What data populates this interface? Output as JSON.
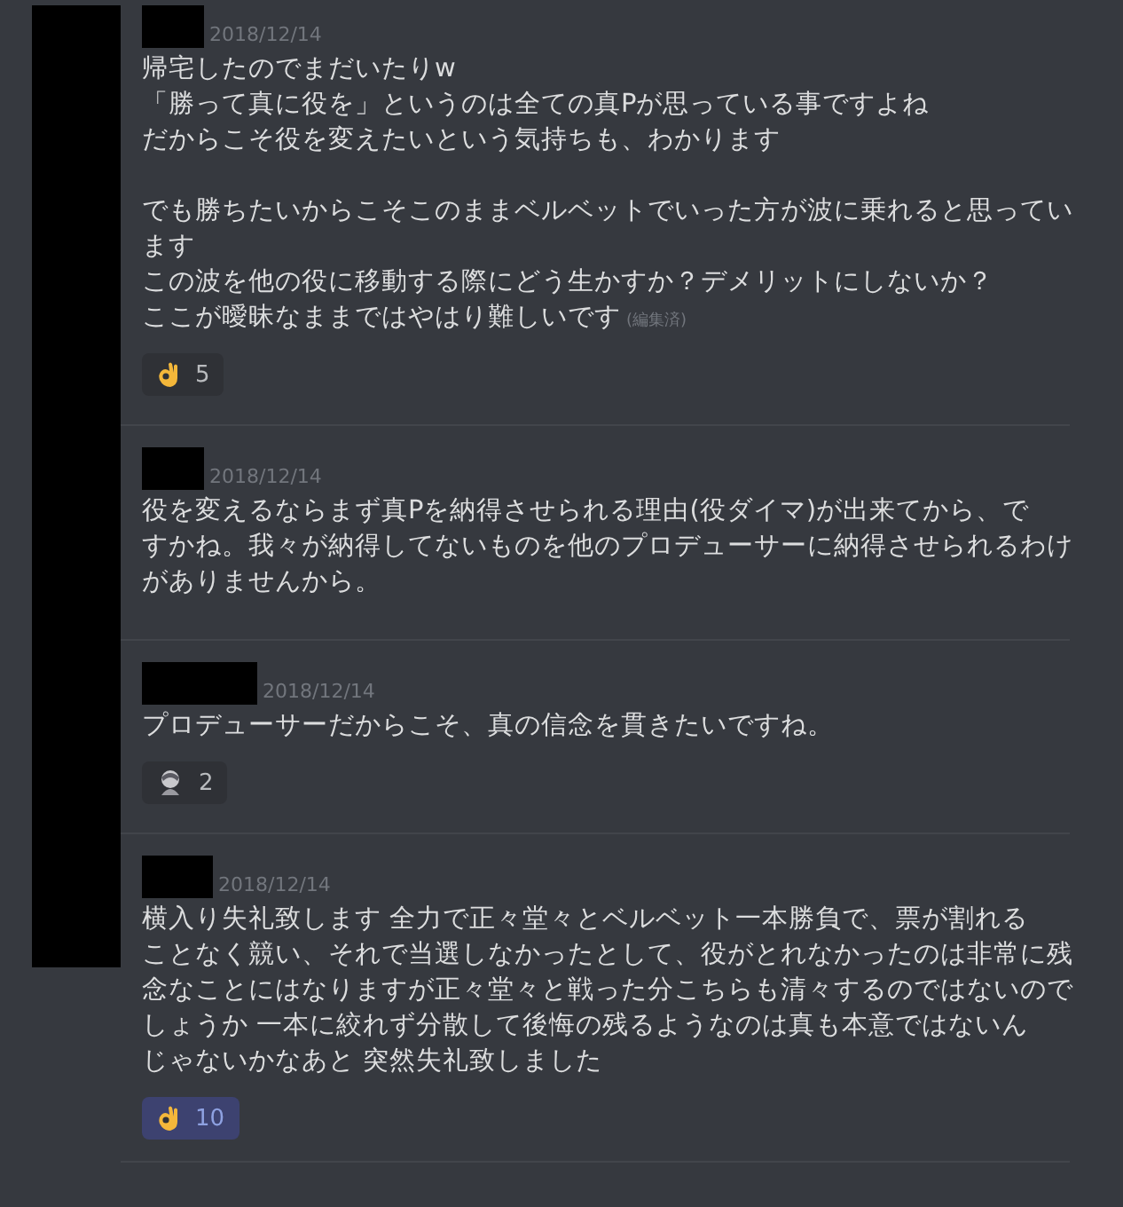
{
  "messages": [
    {
      "timestamp": "2018/12/14",
      "paragraphs": [
        [
          "帰宅したのでまだいたりw",
          "「勝って真に役を」というのは全ての真Pが思っている事ですよね",
          "だからこそ役を変えたいという気持ちも、わかります"
        ],
        [
          "でも勝ちたいからこそこのままベルベットでいった方が波に乗れると思ってい",
          "ます",
          "この波を他の役に移動する際にどう生かすか？デメリットにしないか？",
          "ここが曖昧なままではやはり難しいです"
        ]
      ],
      "edited_label": "(編集済)",
      "reactions": [
        {
          "kind": "ok",
          "count": "5",
          "selected": false
        }
      ]
    },
    {
      "timestamp": "2018/12/14",
      "paragraphs": [
        [
          "役を変えるならまず真Pを納得させられる理由(役ダイマ)が出来てから、で",
          "すかね。我々が納得してないものを他のプロデューサーに納得させられるわけ",
          "がありませんから。"
        ]
      ]
    },
    {
      "timestamp": "2018/12/14",
      "paragraphs": [
        [
          "プロデューサーだからこそ、真の信念を貫きたいですね。"
        ]
      ],
      "reactions": [
        {
          "kind": "custom",
          "count": "2",
          "selected": false
        }
      ]
    },
    {
      "timestamp": "2018/12/14",
      "paragraphs": [
        [
          "横入り失礼致します 全力で正々堂々とベルベット一本勝負で、票が割れる",
          "ことなく競い、それで当選しなかったとして、役がとれなかったのは非常に残",
          "念なことにはなりますが正々堂々と戦った分こちらも清々するのではないので",
          "しょうか 一本に絞れず分散して後悔の残るようなのは真も本意ではないん",
          "じゃないかなあと 突然失礼致しました"
        ]
      ],
      "reactions": [
        {
          "kind": "ok",
          "count": "10",
          "selected": true
        }
      ]
    }
  ]
}
